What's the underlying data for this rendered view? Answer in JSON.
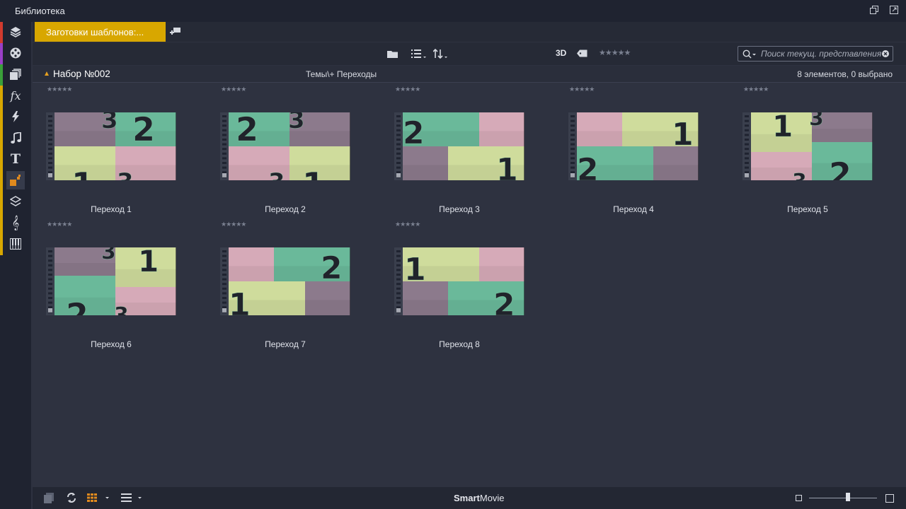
{
  "window": {
    "title": "Библиотека"
  },
  "sidebar": {
    "items": [
      {
        "icon": "project-bin-icon",
        "strip": "#d13a2e"
      },
      {
        "icon": "film-reel-icon",
        "strip": "#9a3fc7"
      },
      {
        "icon": "collections-icon",
        "strip": "#3aa03a"
      },
      {
        "icon": "fx-icon",
        "strip": "#d8a700"
      },
      {
        "icon": "lightning-icon",
        "strip": "#d8a700"
      },
      {
        "icon": "music-note-icon",
        "strip": "#d8a700"
      },
      {
        "icon": "title-t-icon",
        "strip": "#d8a700"
      },
      {
        "icon": "montage-icon",
        "strip": "#d8a700"
      },
      {
        "icon": "layers-icon",
        "strip": "#d8a700"
      },
      {
        "icon": "treble-clef-icon",
        "strip": "#d8a700"
      },
      {
        "icon": "piano-keys-icon",
        "strip": "#d8a700"
      }
    ],
    "active_index": 7,
    "fx_label": "fx",
    "t_label": "T"
  },
  "tabs": {
    "active_label": "Заготовки шаблонов:..."
  },
  "toolbar": {
    "label_3d": "3D",
    "search_placeholder": "Поиск текущ. представления",
    "stars": "★★★★★"
  },
  "group": {
    "name": "Набор №002",
    "path": "Темы\\+ Переходы",
    "count": "8 элементов, 0 выбрано"
  },
  "items": [
    {
      "label": "Переход 1",
      "stars": "★★★★★"
    },
    {
      "label": "Переход 2",
      "stars": "★★★★★"
    },
    {
      "label": "Переход 3",
      "stars": "★★★★★"
    },
    {
      "label": "Переход 4",
      "stars": "★★★★★"
    },
    {
      "label": "Переход 5",
      "stars": "★★★★★"
    },
    {
      "label": "Переход 6",
      "stars": "★★★★★"
    },
    {
      "label": "Переход 7",
      "stars": "★★★★★"
    },
    {
      "label": "Переход 8",
      "stars": "★★★★★"
    }
  ],
  "bottombar": {
    "brand_bold": "Smart",
    "brand_rest": "Movie",
    "zoom_level": 0.57
  },
  "colors": {
    "accent": "#d8a700",
    "tile_mauve": "#8c7a8c",
    "tile_green": "#6ab99a",
    "tile_yellow": "#cfdc9c",
    "tile_pink": "#d6aab8"
  }
}
